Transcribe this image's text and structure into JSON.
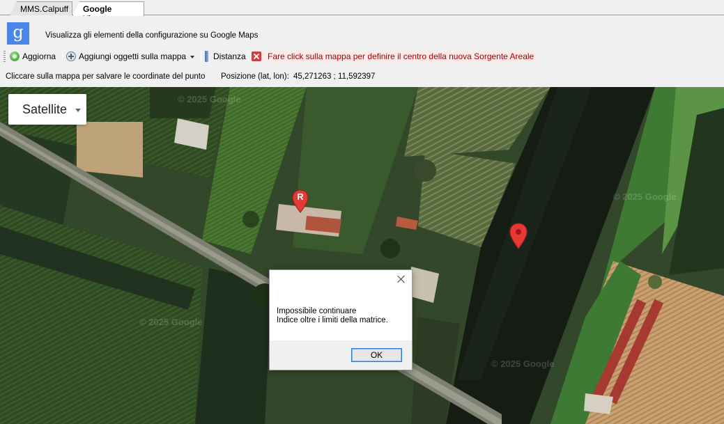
{
  "tabs": [
    {
      "label": "MMS.Calpuff",
      "active": false
    },
    {
      "label": "Google Viewer",
      "active": true
    }
  ],
  "header": {
    "logo_letter": "g",
    "logo_color": "#4a86e8",
    "description": "Visualizza gli elementi della configurazione su Google Maps"
  },
  "toolbar": {
    "refresh_label": "Aggiorna",
    "refresh_icon": "refresh-icon",
    "add_objects_label": "Aggiungi oggetti sulla mappa",
    "add_objects_icon": "add-icon",
    "distance_label": "Distanza",
    "distance_icon": "ruler-icon",
    "message": "Fare click sulla mappa per definire il centro della nuova Sorgente Areale",
    "message_icon": "error-x-icon",
    "message_color": "#a00000"
  },
  "status": {
    "instruction": "Cliccare sulla mappa per salvare le coordinate del punto",
    "position_label": "Posizione (lat, lon):",
    "position_value": "45,271263 ; 11,592397"
  },
  "map": {
    "type_selector": "Satellite",
    "marker_r_label": "R",
    "marker_color": "#e53935",
    "watermark": "© 2025 Google"
  },
  "dialog": {
    "line1": "Impossibile continuare",
    "line2": "Indice oltre i limiti della matrice.",
    "ok_label": "OK"
  }
}
